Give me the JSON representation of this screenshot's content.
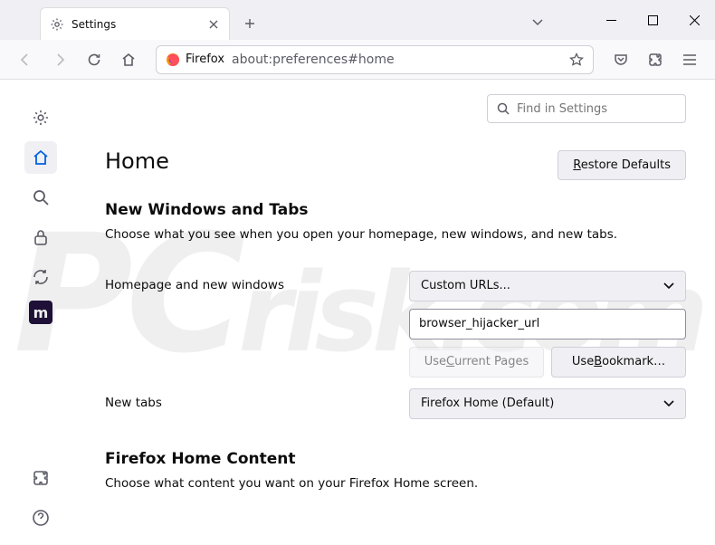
{
  "tab": {
    "label": "Settings"
  },
  "urlbar": {
    "identity": "Firefox",
    "url": "about:preferences#home"
  },
  "toolbar_right": {},
  "search": {
    "placeholder": "Find in Settings"
  },
  "page": {
    "title": "Home",
    "restore": "Restore Defaults"
  },
  "section1": {
    "title": "New Windows and Tabs",
    "desc": "Choose what you see when you open your homepage, new windows, and new tabs."
  },
  "home_windows": {
    "label": "Homepage and new windows",
    "select": "Custom URLs...",
    "value": "browser_hijacker_url",
    "use_current": "Use Current Pages",
    "use_bookmark": "Use Bookmark…"
  },
  "new_tabs": {
    "label": "New tabs",
    "select": "Firefox Home (Default)"
  },
  "section2": {
    "title": "Firefox Home Content",
    "desc": "Choose what content you want on your Firefox Home screen."
  }
}
